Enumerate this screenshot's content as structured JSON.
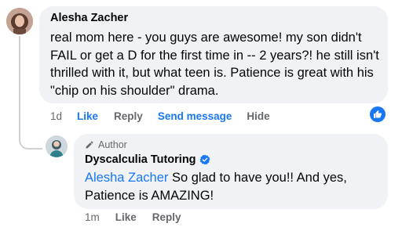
{
  "comment": {
    "author": "Alesha Zacher",
    "text": "real mom here - you guys are awesome! my son didn't FAIL or get a D for the first time in -- 2 years?! he still isn't thrilled with it, but what teen is. Patience is great with his \"chip on his shoulder\" drama.",
    "actions": {
      "time": "1d",
      "like": "Like",
      "reply": "Reply",
      "send_message": "Send message",
      "hide": "Hide"
    },
    "reaction_icon": "thumbs-up-icon"
  },
  "reply": {
    "badge": "Author",
    "author": "Dyscalculia Tutoring",
    "verified_icon": "verified-badge-icon",
    "mention": "Alesha Zacher",
    "text": " So glad to have you!! And yes, Patience is AMAZING!",
    "actions": {
      "time": "1m",
      "like": "Like",
      "reply": "Reply"
    }
  },
  "colors": {
    "link_blue": "#1877f2",
    "bubble_bg": "#f0f2f5",
    "meta_gray": "#65676b"
  }
}
